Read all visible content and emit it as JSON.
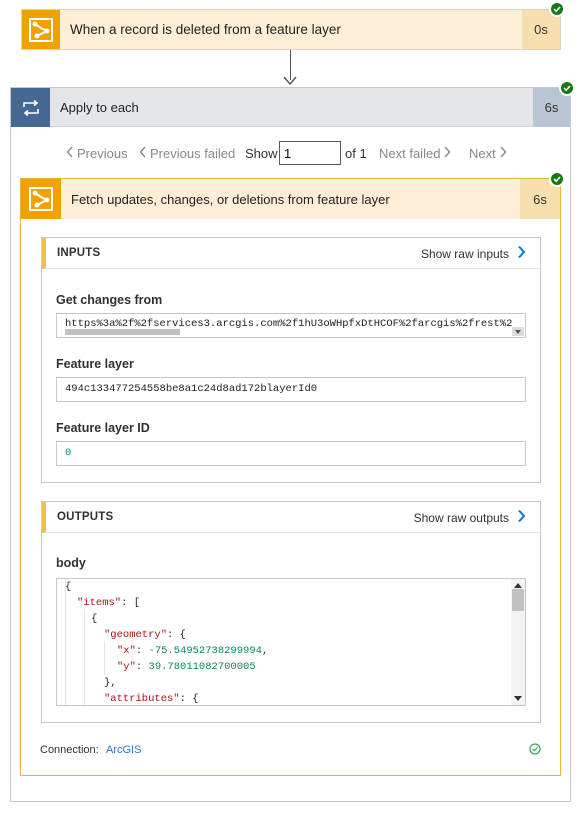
{
  "trigger": {
    "title": "When a record is deleted from a feature layer",
    "duration": "0s"
  },
  "loop": {
    "title": "Apply to each",
    "duration": "6s"
  },
  "pagination": {
    "previous": "Previous",
    "previous_failed": "Previous failed",
    "show": "Show",
    "page_value": "1",
    "of_total": "of 1",
    "next_failed": "Next failed",
    "next": "Next"
  },
  "action": {
    "title": "Fetch updates, changes, or deletions from feature layer",
    "duration": "6s"
  },
  "inputs": {
    "title": "INPUTS",
    "show_raw": "Show raw inputs",
    "fields": [
      {
        "label": "Get changes from",
        "value": "https%3a%2f%2fservices3.arcgis.com%2f1hU3oWHpfxDtHCOF%2farcgis%2frest%2"
      },
      {
        "label": "Feature layer",
        "value": "494c133477254558be8a1c24d8ad172blayerId0"
      },
      {
        "label": "Feature layer ID",
        "value": "0"
      }
    ]
  },
  "outputs": {
    "title": "OUTPUTS",
    "show_raw": "Show raw outputs",
    "body_label": "body",
    "code": {
      "l1": "{",
      "items_key": "\"items\"",
      "items_rest": ": [",
      "l3": "{",
      "geometry_key": "\"geometry\"",
      "geometry_rest": ": {",
      "x_key": "\"x\"",
      "x_val": "-75.54952738299994",
      "y_key": "\"y\"",
      "y_val": "39.78011082700005",
      "l7": "},",
      "attributes_key": "\"attributes\"",
      "attributes_rest": ": {"
    }
  },
  "connection": {
    "label": "Connection:",
    "value": "ArcGIS"
  },
  "colors": {
    "trigger_accent": "#f2a100",
    "loop_accent": "#476892",
    "success": "#127a12",
    "link": "#2b74c7"
  }
}
